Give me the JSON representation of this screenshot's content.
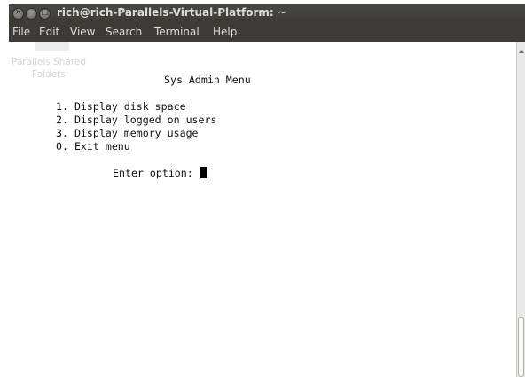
{
  "window": {
    "title": "rich@rich-Parallels-Virtual-Platform: ~",
    "buttons": {
      "close": "×",
      "minimize": "–",
      "maximize": "□"
    }
  },
  "menubar": [
    "File",
    "Edit",
    "View",
    "Search",
    "Terminal",
    "Help"
  ],
  "desktop": {
    "shared_folder_label_1": "Parallels Shared",
    "shared_folder_label_2": "Folders"
  },
  "terminal": {
    "heading": "Sys Admin Menu",
    "options": [
      "1. Display disk space",
      "2. Display logged on users",
      "3. Display memory usage",
      "0. Exit menu"
    ],
    "prompt": "Enter option:"
  },
  "colors": {
    "titlebar": "#3c3b37",
    "terminal_bg": "#ffffff",
    "text": "#111111"
  },
  "icons": [
    "close-icon",
    "minimize-icon",
    "maximize-icon",
    "scroll-up-icon"
  ]
}
